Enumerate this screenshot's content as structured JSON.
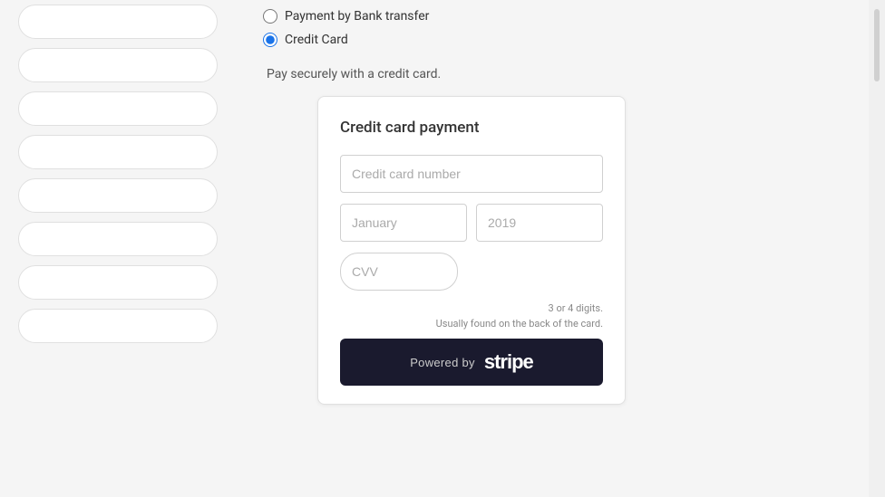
{
  "sidebar": {
    "items": [
      {
        "id": 1
      },
      {
        "id": 2
      },
      {
        "id": 3
      },
      {
        "id": 4
      },
      {
        "id": 5
      },
      {
        "id": 6
      },
      {
        "id": 7
      },
      {
        "id": 8
      }
    ]
  },
  "payment": {
    "options": [
      {
        "id": "bank",
        "label": "Payment by Bank transfer",
        "selected": false
      },
      {
        "id": "card",
        "label": "Credit Card",
        "selected": true
      }
    ],
    "description": "Pay securely with a credit card.",
    "card_form": {
      "title": "Credit card payment",
      "number_placeholder": "Credit card number",
      "month_placeholder": "January",
      "year_placeholder": "2019",
      "cvv_placeholder": "CVV",
      "cvv_hint_line1": "3 or 4 digits.",
      "cvv_hint_line2": "Usually found on the back of the card.",
      "stripe_powered_by": "Powered by",
      "stripe_logo": "stripe"
    }
  }
}
